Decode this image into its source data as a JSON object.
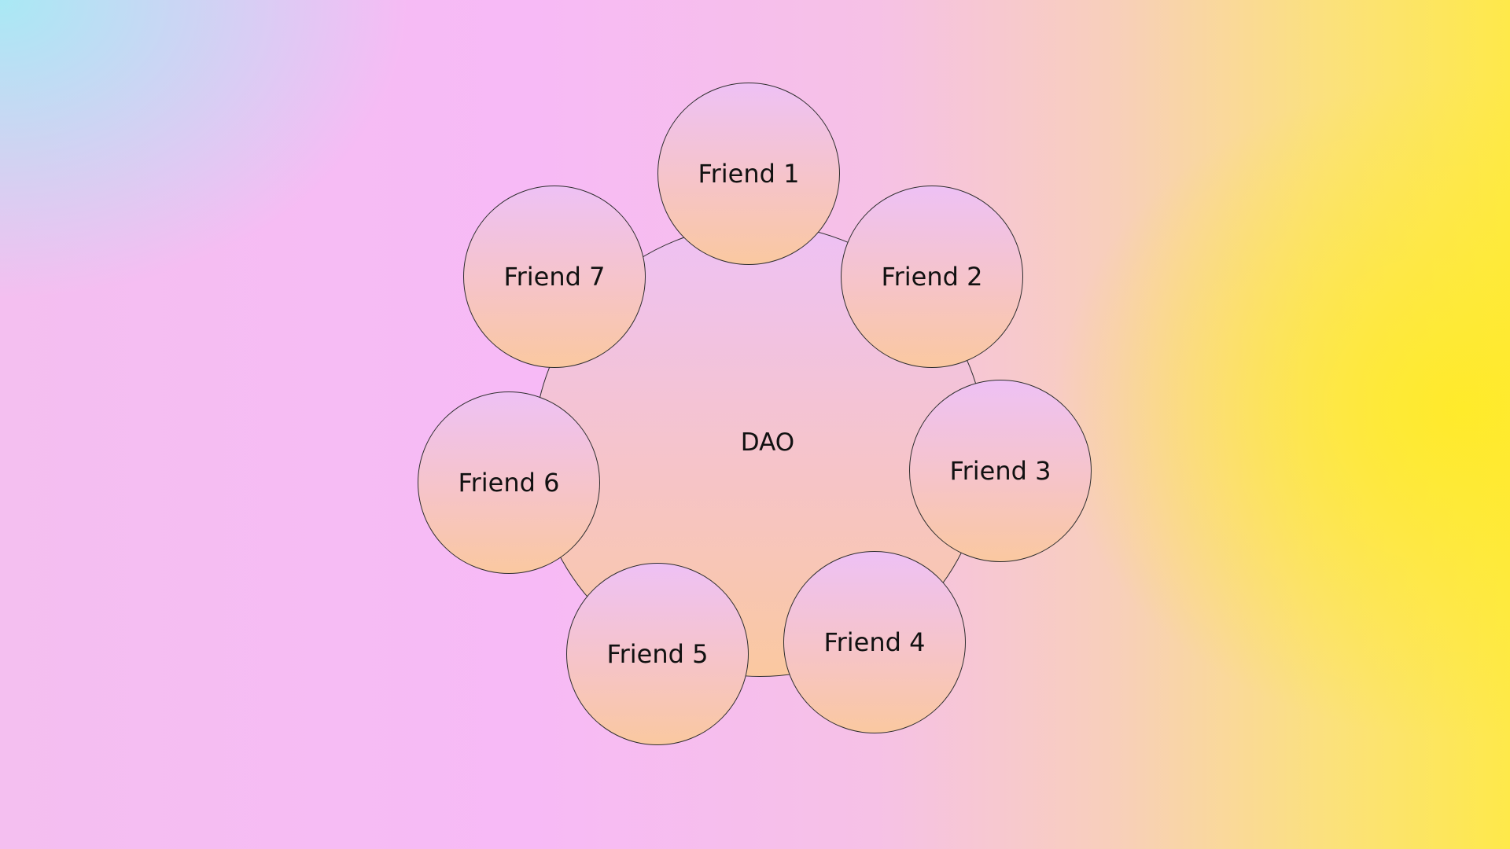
{
  "diagram": {
    "center_label": "DAO",
    "friends": [
      {
        "label": "Friend 1"
      },
      {
        "label": "Friend 2"
      },
      {
        "label": "Friend 3"
      },
      {
        "label": "Friend 4"
      },
      {
        "label": "Friend 5"
      },
      {
        "label": "Friend 6"
      },
      {
        "label": "Friend 7"
      }
    ]
  },
  "colors": {
    "outline": "#2e2e2e",
    "node_fill_top": "#eec1f5",
    "node_fill_bottom": "#fac8a0",
    "background_pink": "#f7baf6",
    "background_yellow": "#fee94a",
    "background_cyan": "#a5ebf5"
  }
}
